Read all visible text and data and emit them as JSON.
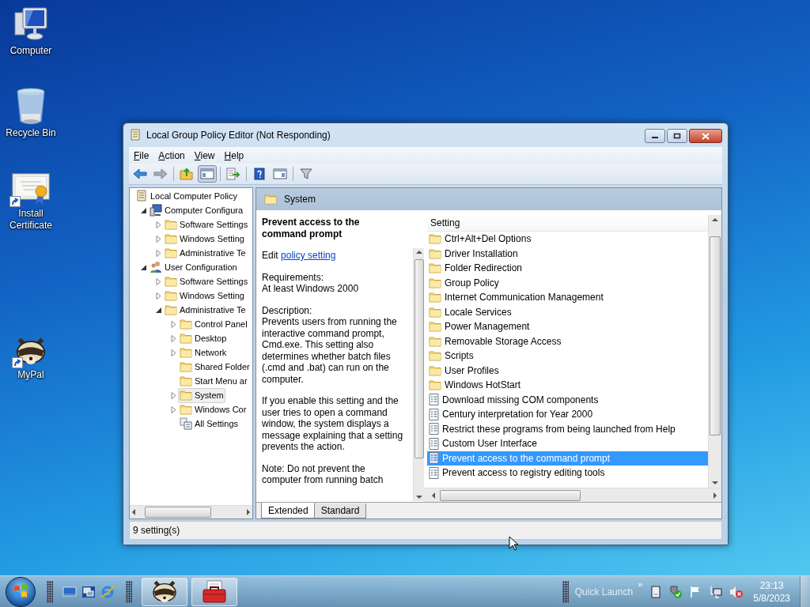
{
  "desktop_icons": [
    {
      "kind": "computer",
      "label": "Computer",
      "shortcut": false
    },
    {
      "kind": "recycle-bin",
      "label": "Recycle Bin",
      "shortcut": false
    },
    {
      "kind": "certificate",
      "label": "Install Certificate",
      "shortcut": true
    },
    {
      "kind": "raccoon",
      "label": "MyPal",
      "shortcut": true
    }
  ],
  "window": {
    "title": "Local Group Policy Editor (Not Responding)"
  },
  "menu": [
    "File",
    "Action",
    "View",
    "Help"
  ],
  "toolbar": [
    {
      "kind": "back",
      "pressed": false
    },
    {
      "kind": "forward",
      "pressed": false
    },
    {
      "kind": "separator"
    },
    {
      "kind": "up-folder",
      "pressed": false
    },
    {
      "kind": "tree-toggle",
      "pressed": true
    },
    {
      "kind": "separator"
    },
    {
      "kind": "export",
      "pressed": false
    },
    {
      "kind": "separator"
    },
    {
      "kind": "help",
      "pressed": false
    },
    {
      "kind": "pane-toggle",
      "pressed": false
    },
    {
      "kind": "separator"
    },
    {
      "kind": "filter",
      "pressed": false
    }
  ],
  "tree": [
    {
      "kind": "policy",
      "label": "Local Computer Policy",
      "expandable": false,
      "selected": false,
      "children": [
        {
          "kind": "computer",
          "label": "Computer Configura",
          "expandable": true,
          "expanded": true,
          "selected": false,
          "children": [
            {
              "kind": "folder",
              "label": "Software Settings",
              "expandable": true,
              "expanded": false,
              "selected": false
            },
            {
              "kind": "folder",
              "label": "Windows Setting",
              "expandable": true,
              "expanded": false,
              "selected": false
            },
            {
              "kind": "folder",
              "label": "Administrative Te",
              "expandable": true,
              "expanded": false,
              "selected": false
            }
          ]
        },
        {
          "kind": "users",
          "label": "User Configuration",
          "expandable": true,
          "expanded": true,
          "selected": false,
          "children": [
            {
              "kind": "folder",
              "label": "Software Settings",
              "expandable": true,
              "expanded": false,
              "selected": false
            },
            {
              "kind": "folder",
              "label": "Windows Setting",
              "expandable": true,
              "expanded": false,
              "selected": false
            },
            {
              "kind": "folder",
              "label": "Administrative Te",
              "expandable": true,
              "expanded": true,
              "selected": false,
              "children": [
                {
                  "kind": "folder",
                  "label": "Control Panel",
                  "expandable": true,
                  "expanded": false,
                  "selected": false
                },
                {
                  "kind": "folder",
                  "label": "Desktop",
                  "expandable": true,
                  "expanded": false,
                  "selected": false
                },
                {
                  "kind": "folder",
                  "label": "Network",
                  "expandable": true,
                  "expanded": false,
                  "selected": false
                },
                {
                  "kind": "folder",
                  "label": "Shared Folder",
                  "expandable": false,
                  "selected": false
                },
                {
                  "kind": "folder",
                  "label": "Start Menu ar",
                  "expandable": false,
                  "selected": false
                },
                {
                  "kind": "folder",
                  "label": "System",
                  "expandable": true,
                  "expanded": false,
                  "selected": true
                },
                {
                  "kind": "folder",
                  "label": "Windows Cor",
                  "expandable": true,
                  "expanded": false,
                  "selected": false
                },
                {
                  "kind": "all-settings",
                  "label": "All Settings",
                  "expandable": false,
                  "selected": false
                }
              ]
            }
          ]
        }
      ]
    }
  ],
  "details": {
    "heading": "System",
    "title": "Prevent access to the command prompt",
    "edit_prefix": "Edit",
    "edit_link": "policy setting",
    "requirements_label": "Requirements:",
    "requirements": "At least Windows 2000",
    "description_label": "Description:",
    "paragraphs": [
      "Prevents users from running the interactive command prompt, Cmd.exe. This setting also determines whether batch files (.cmd and .bat) can run on the computer.",
      "If you enable this setting and the user tries to open a command window, the system displays a message explaining that a setting prevents the action.",
      "Note: Do not prevent the computer from running batch"
    ]
  },
  "settings_list": {
    "column": "Setting",
    "rows": [
      {
        "kind": "folder",
        "name": "Ctrl+Alt+Del Options",
        "selected": false
      },
      {
        "kind": "folder",
        "name": "Driver Installation",
        "selected": false
      },
      {
        "kind": "folder",
        "name": "Folder Redirection",
        "selected": false
      },
      {
        "kind": "folder",
        "name": "Group Policy",
        "selected": false
      },
      {
        "kind": "folder",
        "name": "Internet Communication Management",
        "selected": false
      },
      {
        "kind": "folder",
        "name": "Locale Services",
        "selected": false
      },
      {
        "kind": "folder",
        "name": "Power Management",
        "selected": false
      },
      {
        "kind": "folder",
        "name": "Removable Storage Access",
        "selected": false
      },
      {
        "kind": "folder",
        "name": "Scripts",
        "selected": false
      },
      {
        "kind": "folder",
        "name": "User Profiles",
        "selected": false
      },
      {
        "kind": "folder",
        "name": "Windows HotStart",
        "selected": false
      },
      {
        "kind": "policy",
        "name": "Download missing COM components",
        "selected": false
      },
      {
        "kind": "policy",
        "name": "Century interpretation for Year 2000",
        "selected": false
      },
      {
        "kind": "policy",
        "name": "Restrict these programs from being launched from Help",
        "selected": false
      },
      {
        "kind": "policy",
        "name": "Custom User Interface",
        "selected": false
      },
      {
        "kind": "policy",
        "name": "Prevent access to the command prompt",
        "selected": true
      },
      {
        "kind": "policy",
        "name": "Prevent access to registry editing tools",
        "selected": false
      }
    ]
  },
  "view_tabs": [
    {
      "label": "Extended",
      "selected": true
    },
    {
      "label": "Standard",
      "selected": false
    }
  ],
  "status_bar": "9 setting(s)",
  "taskbar": {
    "quick_launch": [
      {
        "kind": "desktop"
      },
      {
        "kind": "switch-windows"
      },
      {
        "kind": "browser"
      }
    ],
    "tasks": [
      {
        "kind": "raccoon"
      },
      {
        "kind": "toolbox"
      }
    ],
    "quick_launch_label": "Quick Launch",
    "chevron": "»",
    "tray": [
      {
        "kind": "document"
      },
      {
        "kind": "shield-check"
      },
      {
        "kind": "flag"
      },
      {
        "kind": "network"
      },
      {
        "kind": "speaker-muted"
      }
    ],
    "time": "23:13",
    "date": "5/8/2023"
  }
}
